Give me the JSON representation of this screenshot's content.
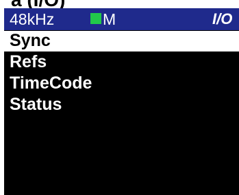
{
  "page": {
    "top_fragment": "a (I/O)"
  },
  "status_bar": {
    "sample_rate": "48kHz",
    "clock_mode": "M",
    "screen_title": "I/O",
    "colors": {
      "background": "#1f2a8c",
      "indicator": "#22c84a",
      "text": "#ffffff"
    }
  },
  "menu": {
    "selected_index": 0,
    "items": [
      {
        "label": "Sync"
      },
      {
        "label": "Refs"
      },
      {
        "label": "TimeCode"
      },
      {
        "label": "Status"
      }
    ],
    "colors": {
      "screen_background": "#000000",
      "item_text": "#ffffff",
      "selected_background": "#ffffff",
      "selected_text": "#000000"
    }
  }
}
